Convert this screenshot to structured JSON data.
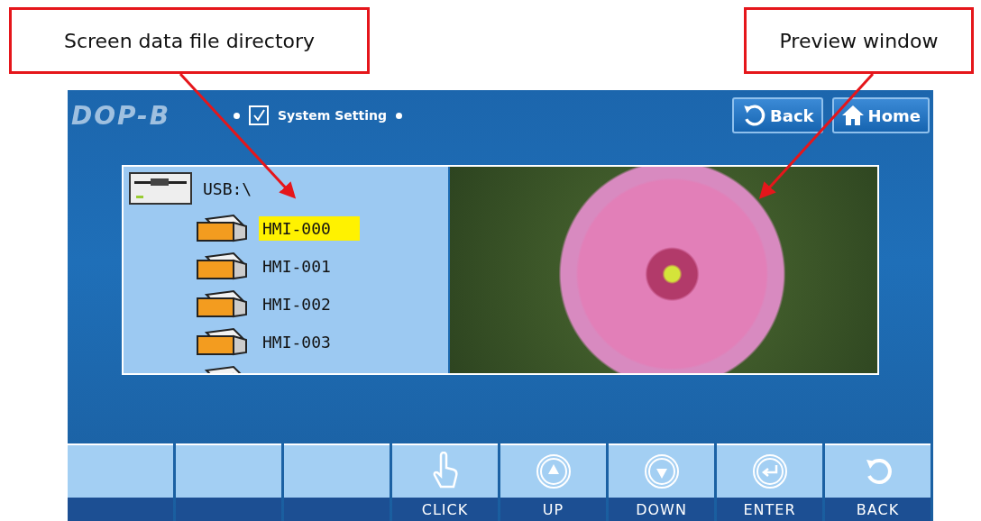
{
  "callouts": [
    {
      "text": "Screen data file directory"
    },
    {
      "text": "Preview window"
    }
  ],
  "header": {
    "logo": "DOP-B",
    "title": "System Setting",
    "checked": true,
    "buttons": [
      {
        "label": "Back",
        "kind": "back"
      },
      {
        "label": "Home",
        "kind": "home"
      }
    ]
  },
  "directory": {
    "root": "USB:\\",
    "files": [
      {
        "name": "HMI-000",
        "selected": true
      },
      {
        "name": "HMI-001",
        "selected": false
      },
      {
        "name": "HMI-002",
        "selected": false
      },
      {
        "name": "HMI-003",
        "selected": false
      }
    ]
  },
  "softkeys": [
    {
      "kind": "blank"
    },
    {
      "kind": "blank"
    },
    {
      "kind": "blank"
    },
    {
      "kind": "click",
      "label": "CLICK"
    },
    {
      "kind": "up",
      "label": "UP"
    },
    {
      "kind": "down",
      "label": "DOWN"
    },
    {
      "kind": "enter",
      "label": "ENTER"
    },
    {
      "kind": "back",
      "label": "BACK"
    }
  ]
}
